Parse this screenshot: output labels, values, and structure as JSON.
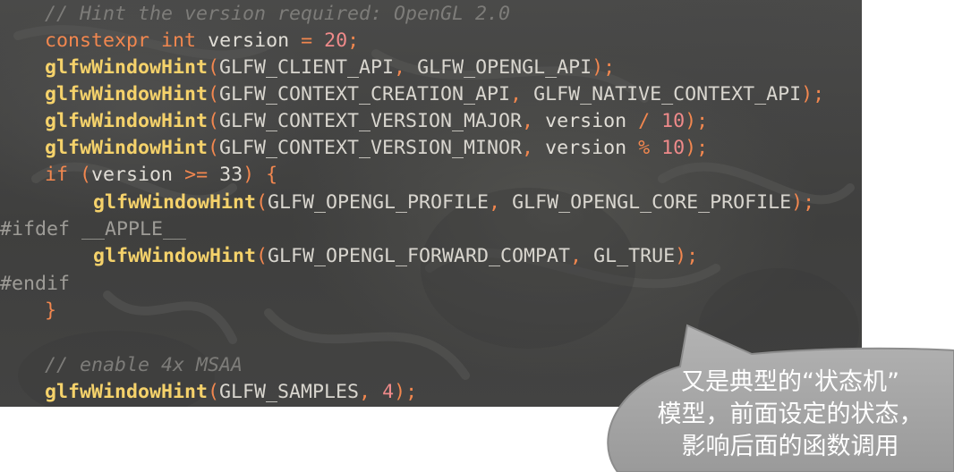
{
  "code": {
    "comment_hint": "// Hint the version required: OpenGL 2.0",
    "kw_constexpr": "constexpr",
    "kw_int": "int",
    "var_version": "version",
    "op_assign": "=",
    "num_20": "20",
    "semicolon": ";",
    "fn_hint": "glfwWindowHint",
    "paren_open": "(",
    "paren_close": ")",
    "comma": ",",
    "c_client_api": "GLFW_CLIENT_API",
    "c_opengl_api": "GLFW_OPENGL_API",
    "c_creation_api": "GLFW_CONTEXT_CREATION_API",
    "c_native_api": "GLFW_NATIVE_CONTEXT_API",
    "c_version_major": "GLFW_CONTEXT_VERSION_MAJOR",
    "c_version_minor": "GLFW_CONTEXT_VERSION_MINOR",
    "op_div": "/",
    "op_mod": "%",
    "num_10": "10",
    "kw_if": "if",
    "op_ge": ">=",
    "num_33": "33",
    "brace_open": "{",
    "brace_close": "}",
    "c_profile": "GLFW_OPENGL_PROFILE",
    "c_core_profile": "GLFW_OPENGL_CORE_PROFILE",
    "pp_ifdef": "#ifdef __APPLE__",
    "c_forward_compat": "GLFW_OPENGL_FORWARD_COMPAT",
    "c_gl_true": "GL_TRUE",
    "pp_endif": "#endif",
    "comment_msaa": "// enable 4x MSAA",
    "c_samples": "GLFW_SAMPLES",
    "num_4": "4"
  },
  "callout": {
    "line1": "又是典型的“状态机”",
    "line2": "模型，前面设定的状态，",
    "line3": "影响后面的函数调用"
  },
  "colors": {
    "comment": "#7d7c79",
    "keyword": "#f2874f",
    "function": "#f5d26b",
    "number": "#ef8a8a",
    "identifier": "#e0ddd6",
    "preprocessor": "#9e9c97",
    "callout_fill": "#a6a6a6",
    "editor_bg": "#454544"
  }
}
